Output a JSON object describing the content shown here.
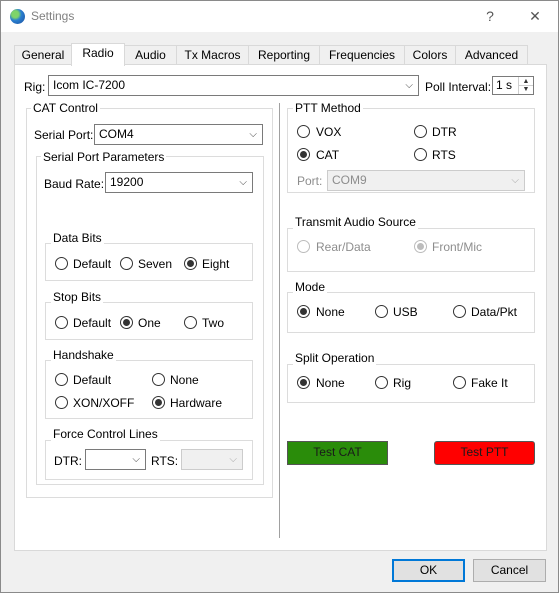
{
  "window": {
    "title": "Settings",
    "help_glyph": "?",
    "close_glyph": "✕"
  },
  "tabs": [
    {
      "label": "General"
    },
    {
      "label": "Radio"
    },
    {
      "label": "Audio"
    },
    {
      "label": "Tx Macros"
    },
    {
      "label": "Reporting"
    },
    {
      "label": "Frequencies"
    },
    {
      "label": "Colors"
    },
    {
      "label": "Advanced"
    }
  ],
  "active_tab": "Radio",
  "rig": {
    "label": "Rig:",
    "value": "Icom IC-7200",
    "poll_label": "Poll Interval:",
    "poll_value": "1 s"
  },
  "cat": {
    "title": "CAT Control",
    "serial_port_label": "Serial Port:",
    "serial_port_value": "COM4",
    "params_title": "Serial Port Parameters",
    "baud_label": "Baud Rate:",
    "baud_value": "19200",
    "data_bits": {
      "title": "Data Bits",
      "options": [
        "Default",
        "Seven",
        "Eight"
      ],
      "selected": "Eight"
    },
    "stop_bits": {
      "title": "Stop Bits",
      "options": [
        "Default",
        "One",
        "Two"
      ],
      "selected": "One"
    },
    "handshake": {
      "title": "Handshake",
      "options": [
        "Default",
        "None",
        "XON/XOFF",
        "Hardware"
      ],
      "selected": "Hardware"
    },
    "force": {
      "title": "Force Control Lines",
      "dtr_label": "DTR:",
      "dtr_value": "",
      "rts_label": "RTS:",
      "rts_value": ""
    }
  },
  "ptt": {
    "title": "PTT Method",
    "options": [
      "VOX",
      "DTR",
      "CAT",
      "RTS"
    ],
    "selected": "CAT",
    "port_label": "Port:",
    "port_value": "COM9"
  },
  "tx_audio": {
    "title": "Transmit Audio Source",
    "options": [
      "Rear/Data",
      "Front/Mic"
    ],
    "selected": "Front/Mic"
  },
  "mode": {
    "title": "Mode",
    "options": [
      "None",
      "USB",
      "Data/Pkt"
    ],
    "selected": "None"
  },
  "split": {
    "title": "Split Operation",
    "options": [
      "None",
      "Rig",
      "Fake It"
    ],
    "selected": "None"
  },
  "buttons": {
    "test_cat": "Test CAT",
    "test_ptt": "Test PTT",
    "ok": "OK",
    "cancel": "Cancel"
  },
  "colors": {
    "test_cat": "#2a8c0a",
    "test_ptt": "#ff0000",
    "accent": "#0078d7"
  }
}
